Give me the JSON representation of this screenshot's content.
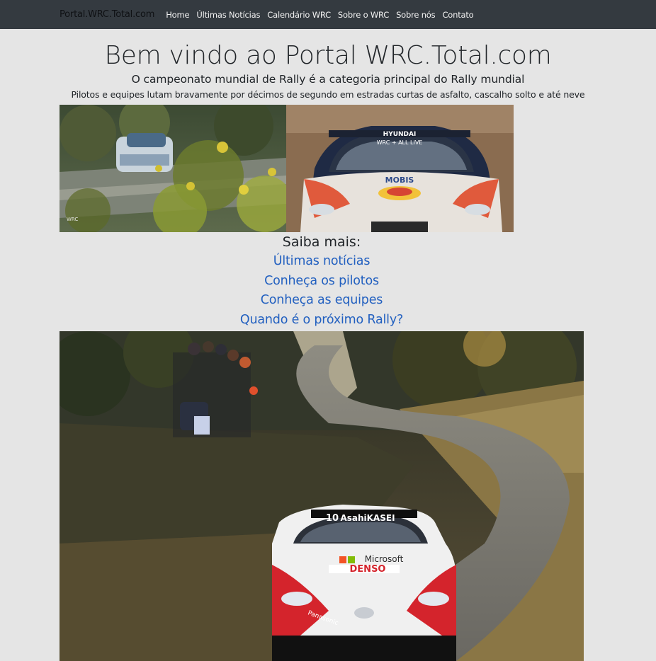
{
  "navbar": {
    "brand": "Portal.WRC.Total.com",
    "links": [
      "Home",
      "Últimas Notícias",
      "Calendário WRC",
      "Sobre o WRC",
      "Sobre nós",
      "Contato"
    ]
  },
  "hero": {
    "title": "Bem vindo ao Portal WRC.Total.com",
    "subtitle": "O campeonato mundial de Rally é a categoria principal do Rally mundial",
    "tagline": "Pilotos e equipes lutam bravamente por décimos de segundo em estradas curtas de asfalto, cascalho solto e até neve"
  },
  "photos": {
    "left_caption": "WRC",
    "right_brand": "HYUNDAI",
    "right_sponsor": "MOBIS",
    "right_banner": "WRC + ALL LIVE"
  },
  "more": {
    "title": "Saiba mais:",
    "links": [
      "Últimas notícias",
      "Conheça os pilotos",
      "Conheça as equipes",
      "Quando é o próximo Rally?"
    ]
  },
  "big_photo": {
    "car_number": "10",
    "sponsor_top": "AsahiKASEI",
    "sponsor_mid": "Microsoft",
    "sponsor_low": "DENSO",
    "side_text": "Panasonic"
  },
  "colors": {
    "navbar_bg": "#343a40",
    "page_bg": "#e5e5e5",
    "link": "#2260c0"
  }
}
